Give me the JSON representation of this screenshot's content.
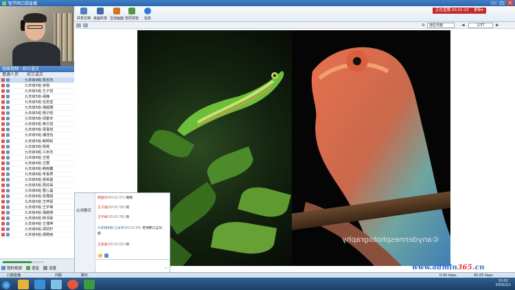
{
  "window": {
    "title": "智学网口袋直播",
    "min": "—",
    "max": "□",
    "close": "✕"
  },
  "left": {
    "panel_title": "班级视频 - 初三语文",
    "list_header": "普通人员",
    "list_top_label": "初三语文",
    "users": [
      "九年级9班-张志杰",
      "九年级5班-徐悦",
      "九年级5班-王子悦",
      "九年级5班-胡静",
      "九年级5班-任宏堂",
      "九年级5班-谭越雅",
      "九年级5班-杨子晗",
      "九年级5班-闵繁天",
      "九年级5班-黄文悦",
      "九年级5班-梁嘉悦",
      "九年级5班-潘佳怡",
      "九年级5班-韩明莉",
      "九年级5班-陈皓",
      "九年级9班-江米杰",
      "九年级6班-王皓",
      "九年级4班-王群",
      "九年级6班-韩雨馨",
      "九年级6班-朱俊男",
      "九年级6班-梁栋嘉",
      "九年级5班-周炫昊",
      "九年级6班-曹心晶",
      "九年级6班-张霞斌",
      "九年级5班-王梓豪",
      "九年级5班-王宇锋",
      "九年级4班-谭越瑛",
      "九年级6班-杨书豪",
      "九年级4班-王博坤",
      "九年级6班-郑凯轩",
      "九年级4班-胡皓雨"
    ],
    "volume_pct": 70,
    "footer": {
      "video": "我的视频",
      "voice": "语音",
      "settings": "设置"
    }
  },
  "toolbar": {
    "items": [
      {
        "label": "共享文档",
        "color": "#4f7fc0"
      },
      {
        "label": "桌面共享",
        "color": "#3e6aa8"
      },
      {
        "label": "互动画面",
        "color": "#d3731f"
      },
      {
        "label": "协同浏览",
        "color": "#4f9a3f"
      },
      {
        "label": "信息",
        "color": "#2f7ad6"
      }
    ],
    "stop_live": "正在直播  00:02:23",
    "more": "更新▾"
  },
  "docbar": {
    "zoom": "适应页面",
    "page": "1/37",
    "prev": "◀",
    "next": "▶"
  },
  "canvas": {
    "watermark": "©anydennesphotography"
  },
  "chat": {
    "tab": "公共聊天",
    "messages": [
      {
        "who": "韩国华",
        "time": "(00:01:57)",
        "text": "嘿嘿"
      },
      {
        "who": "王子雄",
        "time": "(00:01:58)",
        "text": "呃"
      },
      {
        "who": "王宇峰",
        "time": "(00:01:58)",
        "text": "呃"
      },
      {
        "who": "九年级9班-江米杰",
        "time": "(00:02:00)",
        "text": "老师那口言叫"
      },
      {
        "who": "王铭豪",
        "time": "(00:02:02)",
        "text": "呃"
      }
    ],
    "msg_continuation": "呢",
    "send_hint": "↵"
  },
  "statusbar": {
    "left": "口袋直播",
    "network": "问题",
    "chat": "聊天",
    "speed_up": "0.00 kbps",
    "speed_down": "95.05 kbps"
  },
  "taskbar": {
    "time": "10:02",
    "date": "2020/2/1"
  },
  "site_watermark": {
    "prefix": "www.admin",
    "num": "365",
    "suffix": ".cn"
  }
}
